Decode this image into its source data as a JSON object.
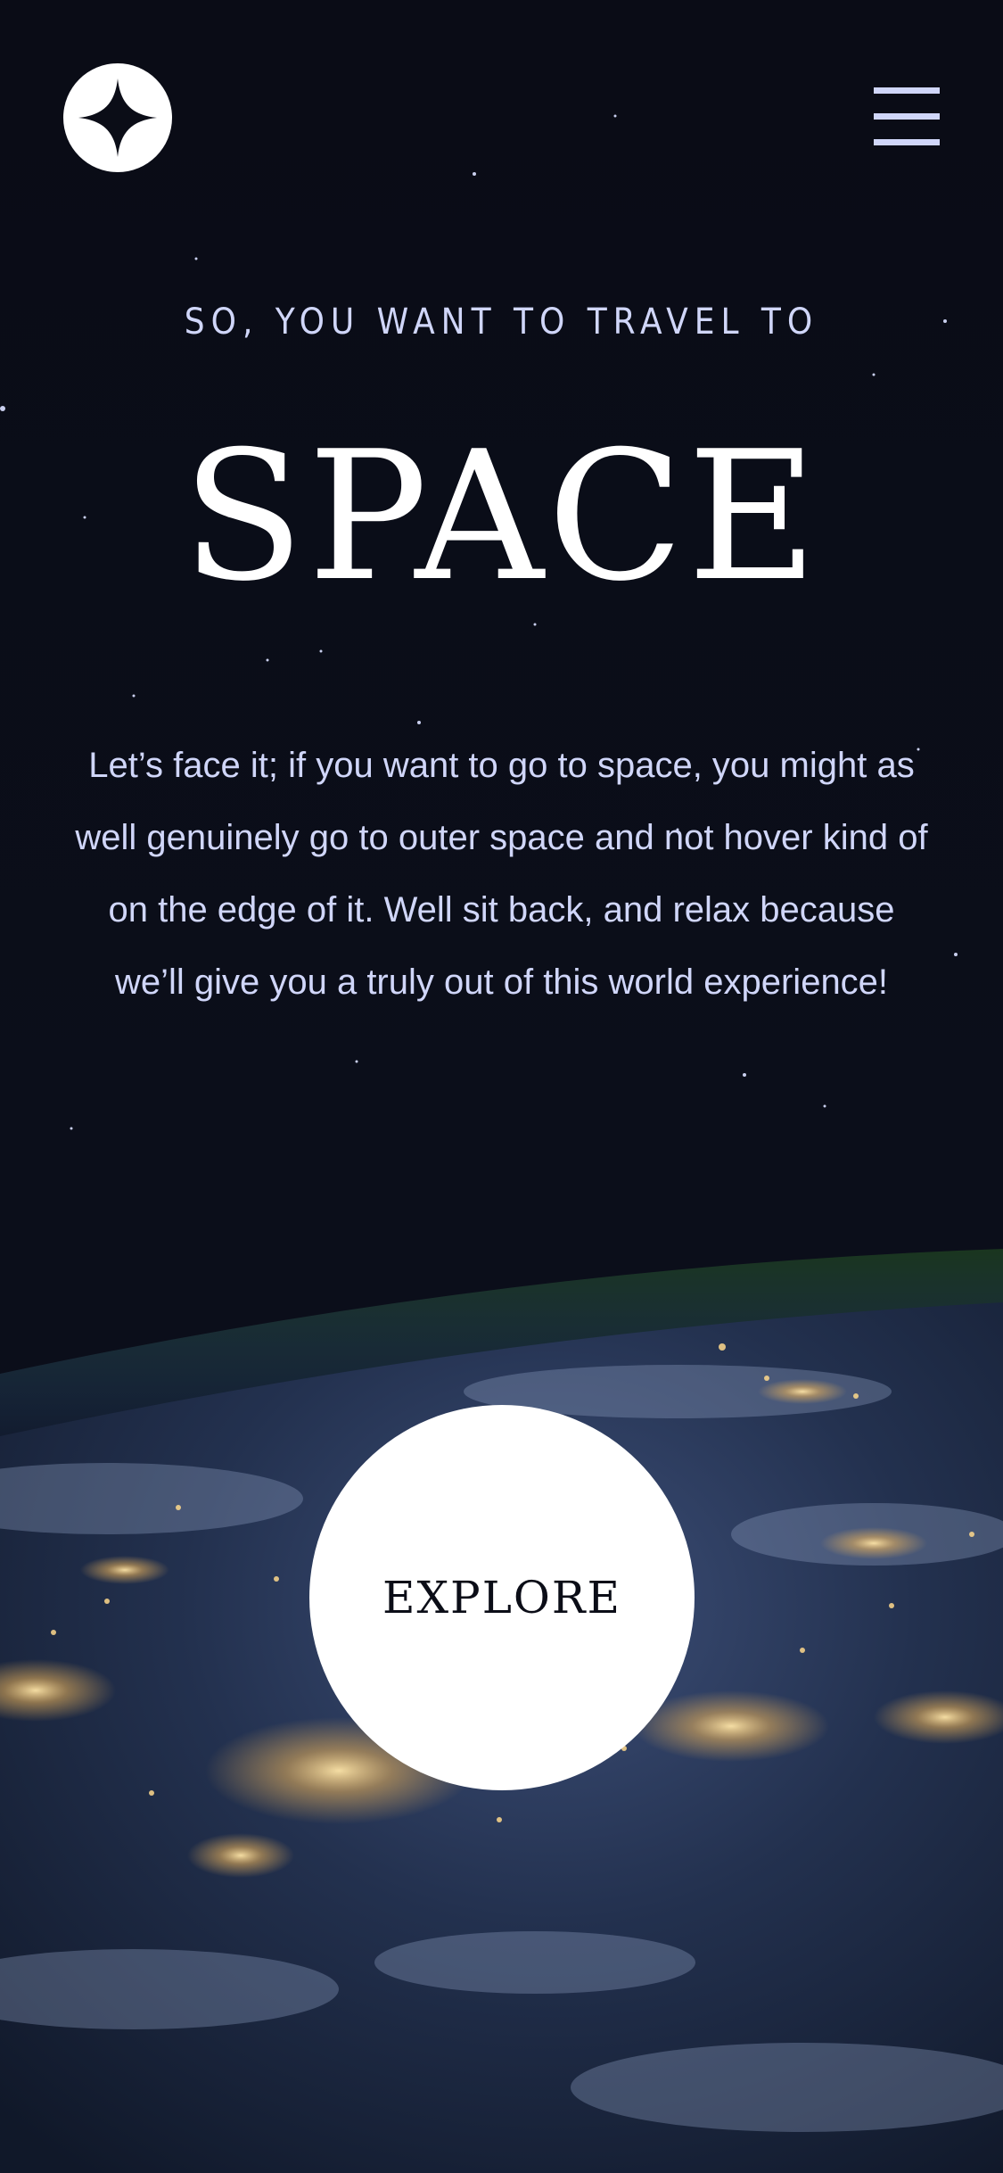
{
  "header": {
    "logo_icon": "star-logo-icon",
    "menu_icon": "hamburger-menu-icon"
  },
  "hero": {
    "eyebrow": "SO, YOU WANT TO TRAVEL TO",
    "title": "SPACE",
    "description": "Let’s face it; if you want to go to space, you might as well genuinely go to outer space and not hover kind of on the edge of it. Well sit back, and relax because we’ll give you a truly out of this world experience!"
  },
  "cta": {
    "label": "EXPLORE"
  },
  "colors": {
    "background": "#0b0d17",
    "accent": "#d0d6f9",
    "white": "#ffffff"
  }
}
